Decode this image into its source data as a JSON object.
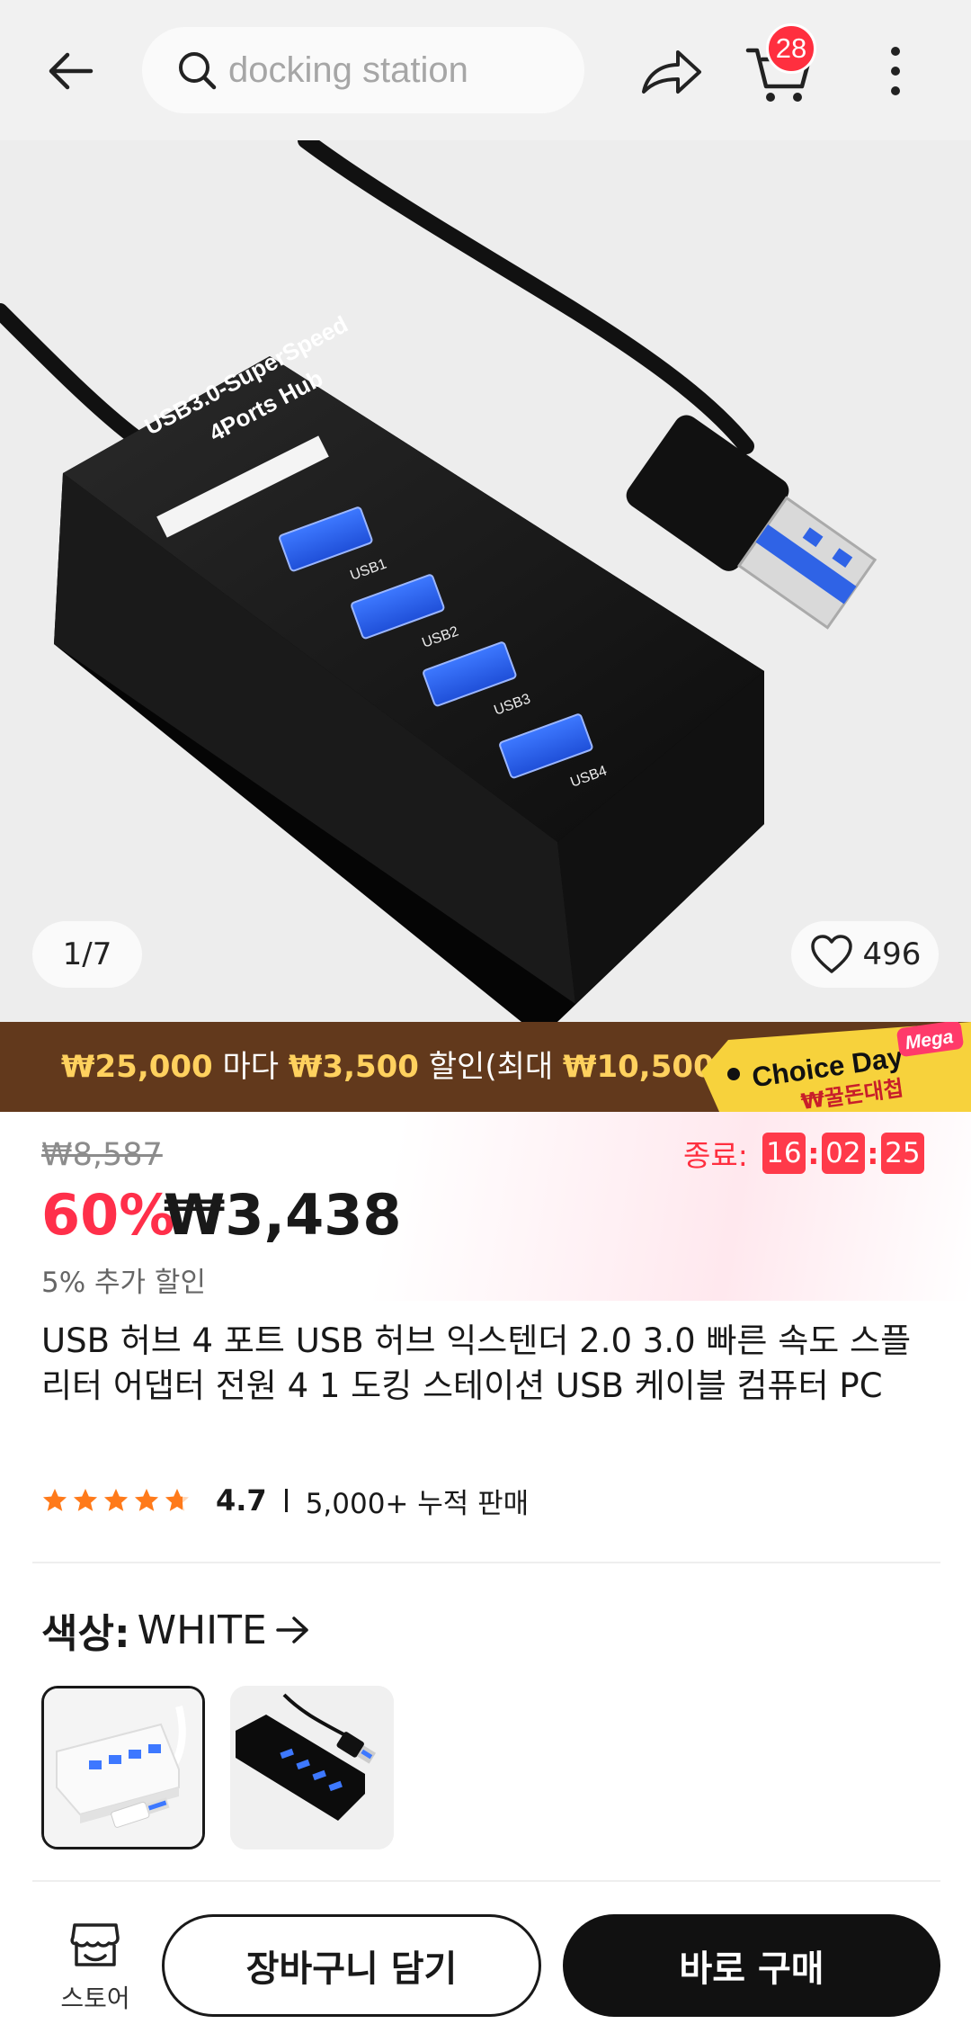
{
  "search": {
    "placeholder": "docking station"
  },
  "header": {
    "cart_count": "28"
  },
  "gallery": {
    "page": "1/7",
    "wishlist_count": "496",
    "hub_text_line1": "USB3.0-SuperSpeed",
    "hub_text_line2": "4Ports Hub",
    "ports": [
      "USB1",
      "USB2",
      "USB3",
      "USB4"
    ]
  },
  "promo": {
    "part1": "₩25,000",
    "part2": " 마다 ",
    "part3": "₩3,500",
    "part4": " 할인(최대 ",
    "part5": "₩10,500",
    "part6": ")",
    "tag_main": "Choice Day",
    "tag_mega": "Mega",
    "tag_sub": "₩꿀돈대첩"
  },
  "price": {
    "original": "₩8,587",
    "timer_label": "종료:",
    "timer_h": "16",
    "timer_m": "02",
    "timer_s": "25",
    "discount": "60%",
    "sale": "₩3,438",
    "extra": "5% 추가 할인"
  },
  "product": {
    "title": "USB 허브 4 포트 USB 허브 익스텐더 2.0 3.0 빠른 속도 스플리터 어댑터 전원 4 1 도킹 스테이션 USB 케이블 컴퓨터 PC",
    "rating": "4.7",
    "stars": 4.7,
    "sold": "5,000+ 누적 판매"
  },
  "options": {
    "color_label": "색상:",
    "color_value": "WHITE"
  },
  "bottom": {
    "store_label": "스토어",
    "add_cart": "장바구니 담기",
    "buy_now": "바로 구매"
  },
  "colors": {
    "accent": "#ff2f4a",
    "promo_bg": "#62391c",
    "promo_highlight": "#ffd15e",
    "badge": "#ff2f3f"
  }
}
